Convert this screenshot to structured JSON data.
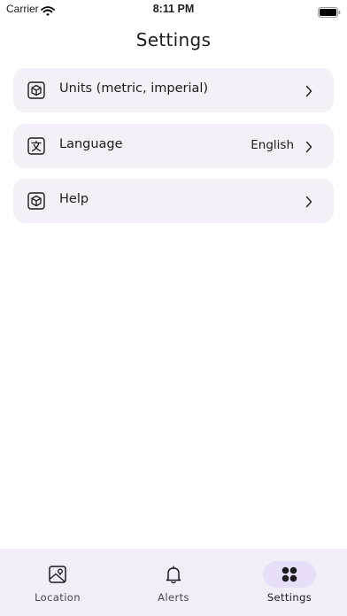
{
  "status_bar": {
    "carrier": "Carrier",
    "time": "8:11 PM"
  },
  "page": {
    "title": "Settings"
  },
  "settings_items": [
    {
      "label": "Units (metric, imperial)",
      "value": "",
      "icon": "cube-icon"
    },
    {
      "label": "Language",
      "value": "English",
      "icon": "translate-icon"
    },
    {
      "label": "Help",
      "value": "",
      "icon": "cube-icon"
    }
  ],
  "bottom_nav": {
    "items": [
      {
        "label": "Location",
        "icon": "map-location-icon",
        "active": false
      },
      {
        "label": "Alerts",
        "icon": "bell-icon",
        "active": false
      },
      {
        "label": "Settings",
        "icon": "grid-icon",
        "active": true
      }
    ]
  },
  "colors": {
    "card_bg": "#f5f0f8",
    "nav_bg": "#f3edf7",
    "active_pill": "#e8def8",
    "text": "#1c1b1f"
  }
}
